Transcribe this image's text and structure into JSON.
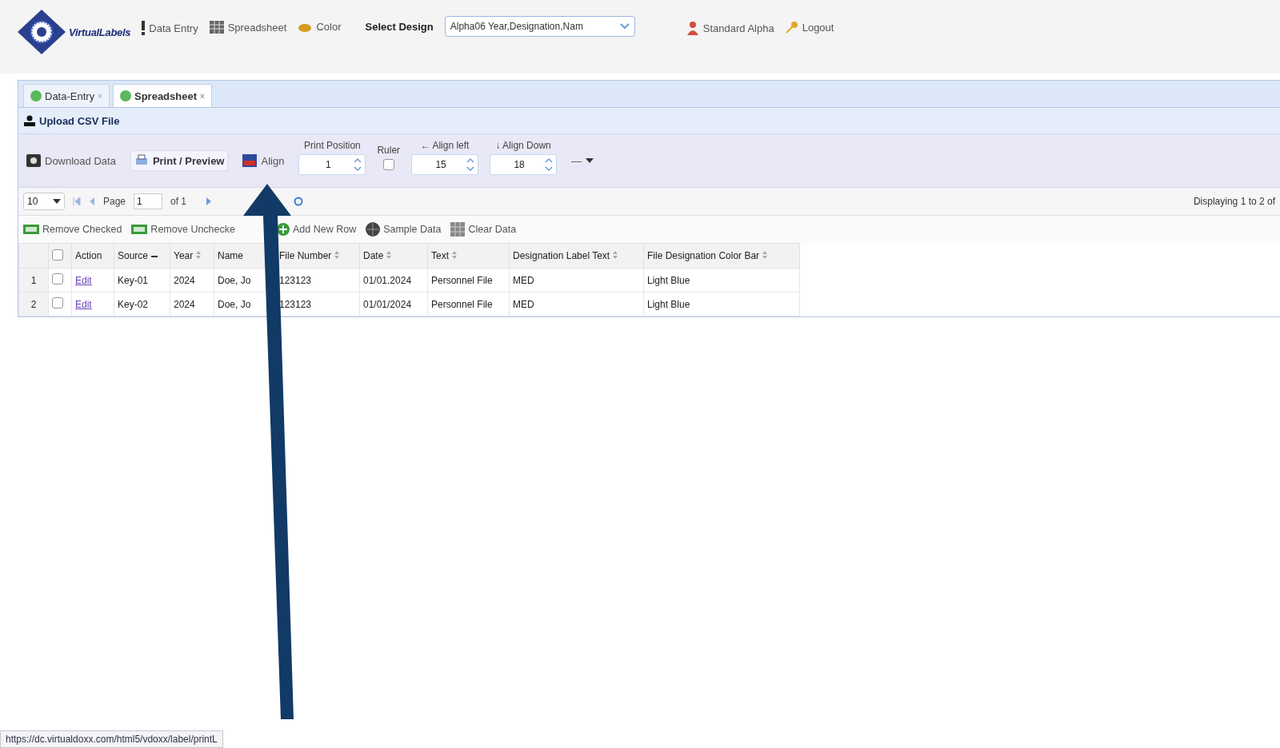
{
  "header": {
    "logo_text": "VirtualLabels",
    "nav": [
      {
        "kind": "bar",
        "label": "Data Entry"
      },
      {
        "kind": "grid",
        "label": "Spreadsheet"
      },
      {
        "kind": "paint",
        "label": "Color"
      }
    ],
    "design_label": "Select Design",
    "design_value": "Alpha06 Year,Designation,Nam",
    "user": "Standard Alpha",
    "logout": "Logout"
  },
  "tabs": [
    {
      "label": "Data-Entry",
      "close": "×",
      "selected": false
    },
    {
      "label": "Spreadsheet",
      "close": "×",
      "selected": true
    }
  ],
  "upload": "Upload CSV File",
  "toolbar": {
    "download": "Download Data",
    "print": "Print / Preview",
    "align": "Align",
    "print_position": {
      "label": "Print Position",
      "value": "1"
    },
    "ruler": {
      "label": "Ruler",
      "checked": false
    },
    "align_left": {
      "label": "← Align left",
      "value": "15"
    },
    "align_down": {
      "label": "↓ Align Down",
      "value": "18"
    },
    "more": "—"
  },
  "pager": {
    "page_size": "10",
    "page": "Page",
    "page_value": "1",
    "of": "of 1",
    "displaying": "Displaying 1 to 2 of"
  },
  "actions": [
    {
      "kind": "remove",
      "label": "Remove Checked"
    },
    {
      "kind": "remove",
      "label": "Remove Unchecke"
    },
    {
      "kind": "add",
      "label": "Add New Row"
    },
    {
      "kind": "sample",
      "label": "Sample Data"
    },
    {
      "kind": "clear",
      "label": "Clear Data"
    }
  ],
  "table": {
    "header_checked": false,
    "columns": [
      {
        "label": "Action"
      },
      {
        "label": "Source",
        "sorted": true
      },
      {
        "label": "Year",
        "sorted": false
      },
      {
        "label": "Name"
      },
      {
        "label": "File Number",
        "sorted": false
      },
      {
        "label": "Date",
        "sorted": false
      },
      {
        "label": "Text",
        "sorted": false
      },
      {
        "label": "Designation Label Text",
        "sorted": false
      },
      {
        "label": "File Designation Color Bar",
        "sorted": false
      }
    ],
    "rows": [
      {
        "number": "1",
        "checked": false,
        "cells": [
          "Edit",
          "Key-01",
          "2024",
          "Doe, Jo",
          "123123",
          "01/01.2024",
          "Personnel File",
          "MED",
          "Light Blue"
        ]
      },
      {
        "number": "2",
        "checked": false,
        "cells": [
          "Edit",
          "Key-02",
          "2024",
          "Doe, Jo",
          "123123",
          "01/01/2024",
          "Personnel File",
          "MED",
          "Light Blue"
        ]
      }
    ]
  },
  "status_bar": "https://dc.virtualdoxx.com/html5/vdoxx/label/printL"
}
